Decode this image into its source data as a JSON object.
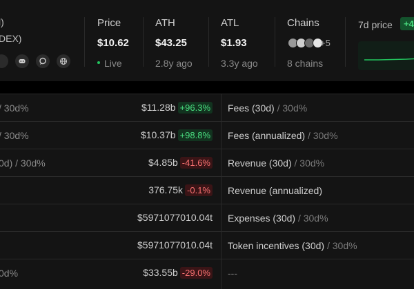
{
  "header": {
    "name_fragment": "l)",
    "sub_fragment": "DEX)",
    "socials": [
      "discord-icon",
      "chat-icon",
      "globe-icon"
    ],
    "price": {
      "label": "Price",
      "value": "$10.62",
      "sub": "Live"
    },
    "ath": {
      "label": "ATH",
      "value": "$43.25",
      "sub": "2.8y ago"
    },
    "atl": {
      "label": "ATL",
      "value": "$1.93",
      "sub": "3.3y ago"
    },
    "chains": {
      "label": "Chains",
      "extra": "+5",
      "sub": "8 chains"
    },
    "seven_day": {
      "label": "7d price",
      "badge": "+4"
    }
  },
  "rows": [
    {
      "left": "/ 30d%",
      "value": "$11.28b",
      "pct": "+96.3%",
      "dir": "pos",
      "metric": "Fees (30d)",
      "suffix": "30d%"
    },
    {
      "left": "/ 30d%",
      "value": "$10.37b",
      "pct": "+98.8%",
      "dir": "pos",
      "metric": "Fees (annualized)",
      "suffix": "30d%"
    },
    {
      "left": "0d) / 30d%",
      "value": "$4.85b",
      "pct": "-41.6%",
      "dir": "neg",
      "metric": "Revenue (30d)",
      "suffix": "30d%"
    },
    {
      "left": "",
      "value": "376.75k",
      "pct": "-0.1%",
      "dir": "neg",
      "metric": "Revenue (annualized)",
      "suffix": ""
    },
    {
      "left": "",
      "value": "$5971077010.04t",
      "pct": "",
      "dir": "",
      "metric": "Expenses (30d)",
      "suffix": "30d%"
    },
    {
      "left": "",
      "value": "$5971077010.04t",
      "pct": "",
      "dir": "",
      "metric": "Token incentives (30d)",
      "suffix": "30d%"
    },
    {
      "left": "0d%",
      "value": "$33.55b",
      "pct": "-29.0%",
      "dir": "neg",
      "metric": "---",
      "suffix": ""
    }
  ],
  "colors": {
    "positive": "#4ade80",
    "negative": "#f87171",
    "accent_live": "#22c55e"
  }
}
